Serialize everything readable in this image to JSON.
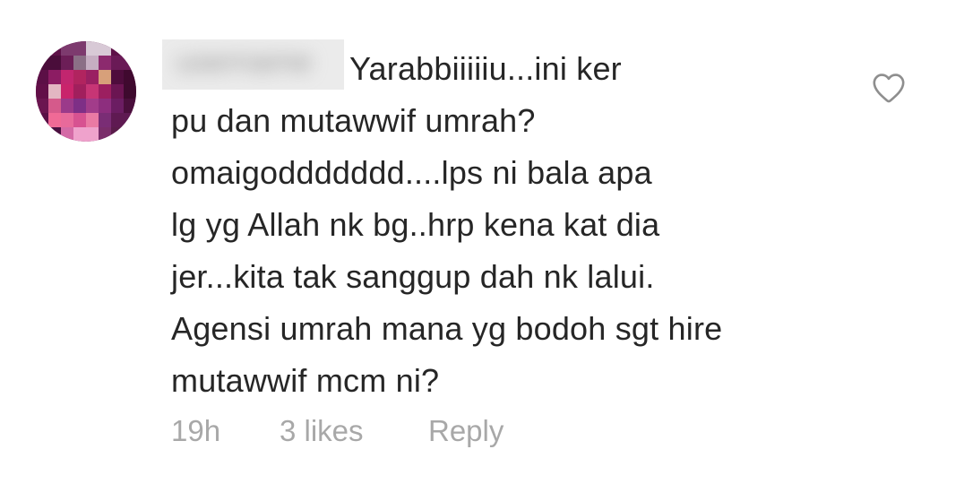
{
  "comment": {
    "username": "username",
    "lines": [
      "Yarabbiiiiiu...ini ker",
      "pu dan mutawwif umrah?",
      "omaigoddddddd....lps ni bala apa",
      "lg yg Allah nk bg..hrp kena kat dia",
      "jer...kita tak sanggup dah nk lalui.",
      "Agensi umrah mana yg bodoh sgt hire",
      "mutawwif mcm ni?"
    ],
    "timestamp": "19h",
    "likes": "3 likes",
    "reply_label": "Reply",
    "like_icon": "heart-outline-icon"
  },
  "colors": {
    "text": "#262626",
    "meta": "#a8a8a8",
    "username_blur": "#ebebeb"
  }
}
